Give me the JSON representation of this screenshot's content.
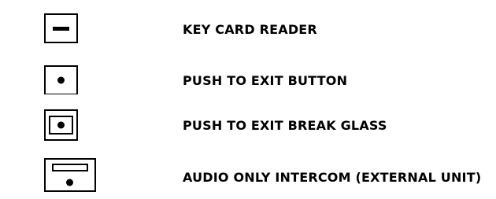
{
  "legend": {
    "items": [
      {
        "label": "KEY CARD READER",
        "icon": "key-card-reader-icon"
      },
      {
        "label": "PUSH TO EXIT BUTTON",
        "icon": "push-to-exit-button-icon"
      },
      {
        "label": "PUSH TO EXIT BREAK GLASS",
        "icon": "push-to-exit-break-glass-icon"
      },
      {
        "label": "AUDIO ONLY INTERCOM (EXTERNAL UNIT)",
        "icon": "audio-only-intercom-icon"
      }
    ],
    "colors": {
      "stroke": "#000000",
      "background": "#ffffff"
    }
  }
}
